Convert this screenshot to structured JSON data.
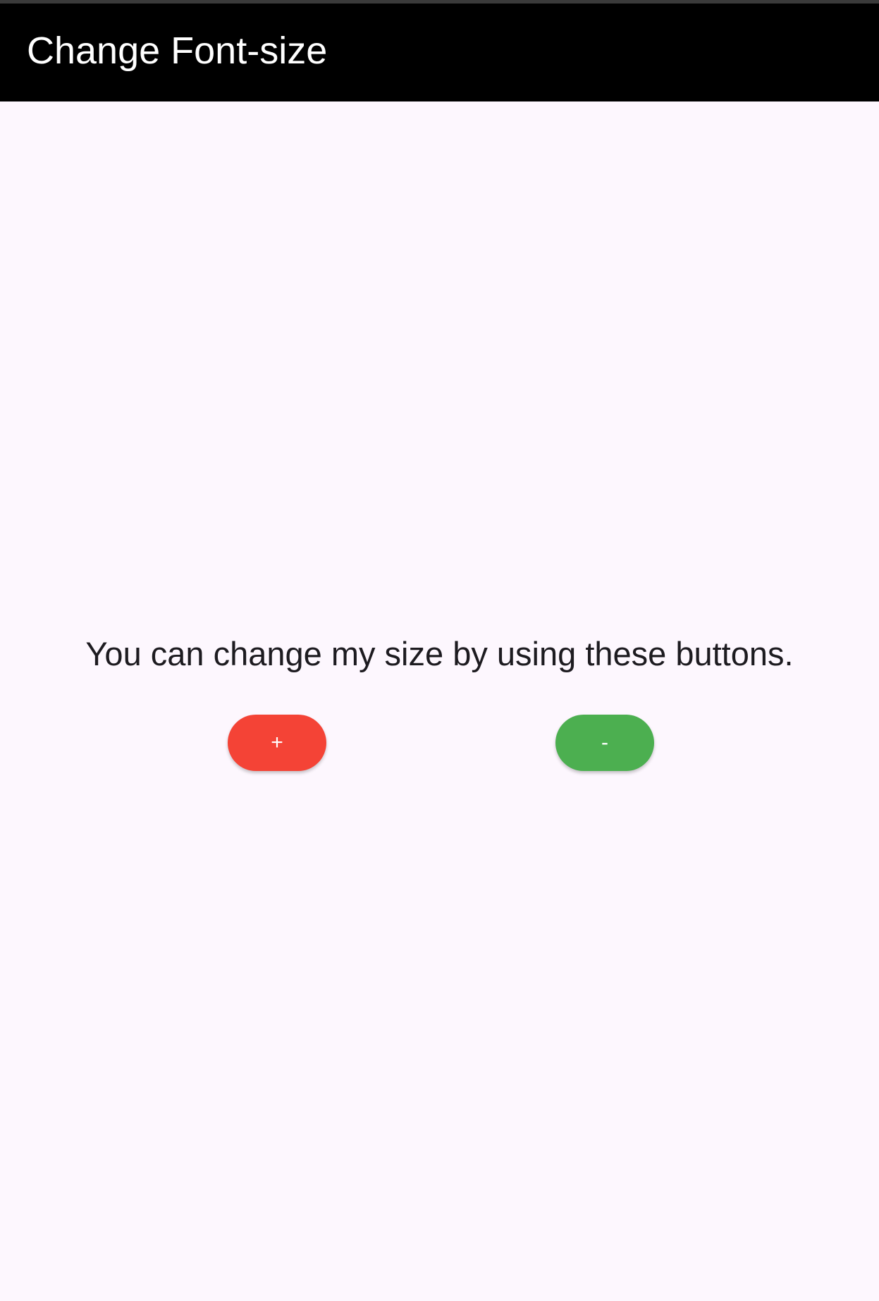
{
  "app_bar": {
    "title": "Change Font-size",
    "background": "#000000",
    "title_color": "#ffffff"
  },
  "main": {
    "message": "You can change my size by using these buttons.",
    "background": "#fdf7fe"
  },
  "buttons": {
    "increase": {
      "label": "+",
      "color": "#f44336"
    },
    "decrease": {
      "label": "-",
      "color": "#4caf50"
    }
  }
}
